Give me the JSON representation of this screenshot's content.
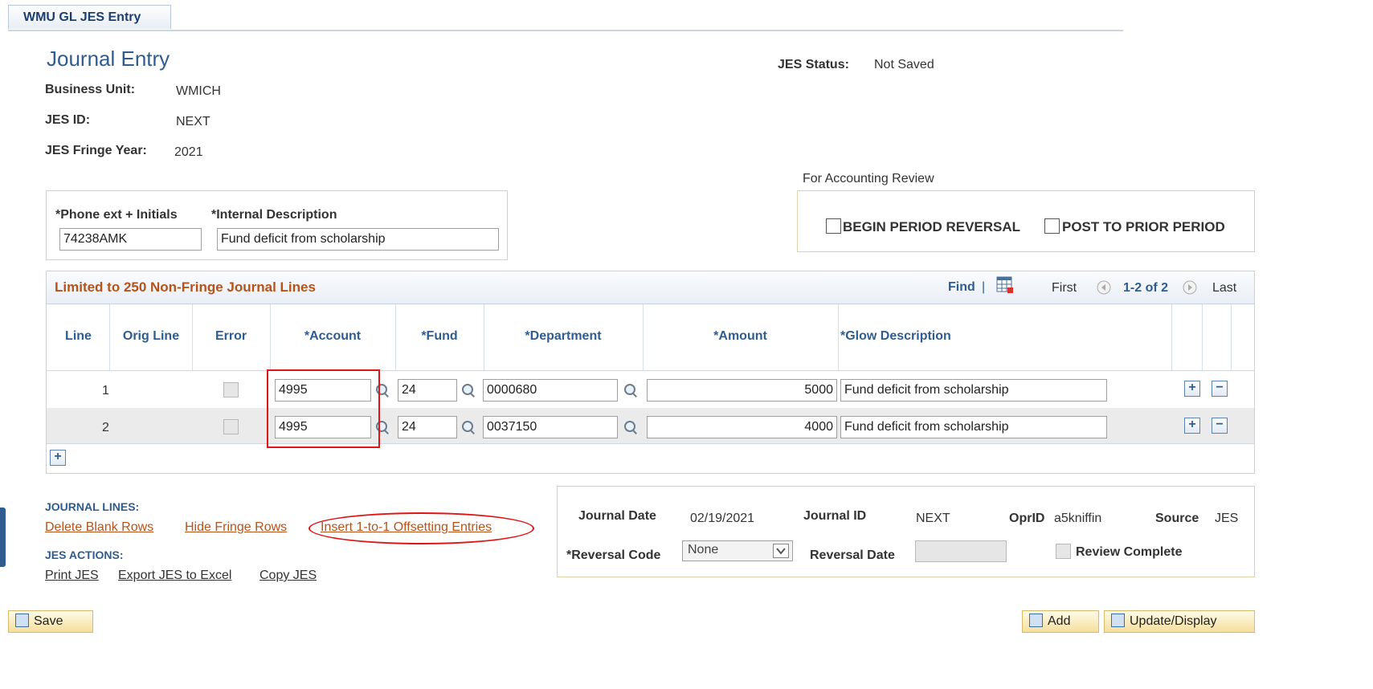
{
  "tab": {
    "label": "WMU GL JES Entry"
  },
  "page": {
    "title": "Journal Entry"
  },
  "status": {
    "label": "JES Status:",
    "value": "Not Saved"
  },
  "info": {
    "business_unit_label": "Business Unit:",
    "business_unit": "WMICH",
    "jes_id_label": "JES ID:",
    "jes_id": "NEXT",
    "fringe_year_label": "JES Fringe Year:",
    "fringe_year": "2021"
  },
  "form": {
    "phone_label": "*Phone ext + Initials",
    "phone_value": "74238AMK",
    "desc_label": "*Internal Description",
    "desc_value": "Fund deficit from scholarship"
  },
  "review": {
    "title": "For Accounting Review",
    "begin_reversal": "BEGIN PERIOD REVERSAL",
    "post_prior": "POST TO PRIOR PERIOD"
  },
  "grid": {
    "title": "Limited to 250 Non-Fringe Journal Lines",
    "find": "Find",
    "sep": "|",
    "first": "First",
    "range": "1-2 of 2",
    "last": "Last",
    "columns": {
      "line": "Line",
      "orig_line": "Orig Line",
      "error": "Error",
      "account": "*Account",
      "fund": "*Fund",
      "department": "*Department",
      "amount": "*Amount",
      "glow": "*Glow Description"
    },
    "rows": [
      {
        "line": "1",
        "account": "4995",
        "fund": "24",
        "department": "0000680",
        "amount": "5000",
        "glow": "Fund deficit from scholarship"
      },
      {
        "line": "2",
        "account": "4995",
        "fund": "24",
        "department": "0037150",
        "amount": "4000",
        "glow": "Fund deficit from scholarship"
      }
    ],
    "add_row_symbol": "+",
    "remove_row_symbol": "−"
  },
  "journal_lines": {
    "header": "JOURNAL LINES:",
    "delete_blank": "Delete Blank Rows",
    "hide_fringe": "Hide Fringe Rows",
    "insert_offsetting": "Insert 1-to-1 Offsetting Entries"
  },
  "jes_actions": {
    "header": "JES ACTIONS:",
    "print": "Print JES",
    "export": "Export JES to Excel",
    "copy": "Copy JES"
  },
  "summary": {
    "journal_date_label": "Journal Date",
    "journal_date": "02/19/2021",
    "journal_id_label": "Journal ID",
    "journal_id": "NEXT",
    "oprid_label": "OprID",
    "oprid": "a5kniffin",
    "source_label": "Source",
    "source": "JES",
    "reversal_code_label": "*Reversal Code",
    "reversal_code": "None",
    "reversal_date_label": "Reversal Date",
    "reversal_date": "",
    "review_complete": "Review Complete"
  },
  "buttons": {
    "save": "Save",
    "add": "Add",
    "update_display": "Update/Display"
  },
  "colors": {
    "accent": "#2f5d8f",
    "link": "#b5531b",
    "highlight": "#e01515"
  }
}
